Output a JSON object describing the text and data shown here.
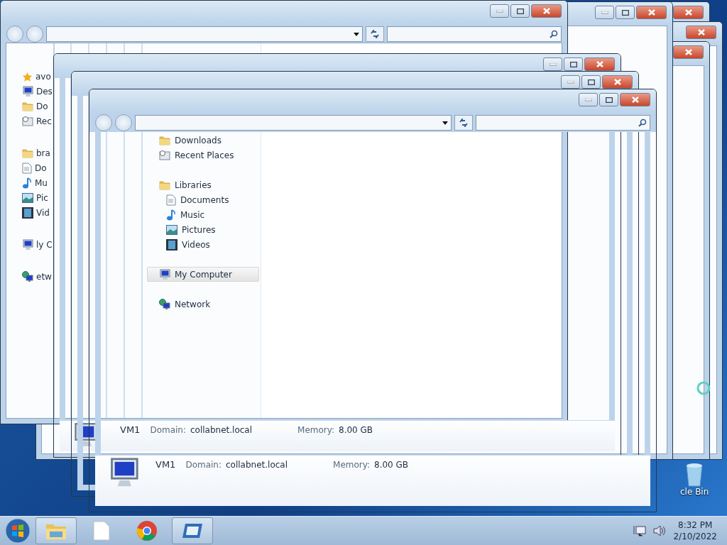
{
  "windows": [
    {
      "kind": "frame"
    },
    {
      "kind": "frame"
    },
    {
      "kind": "frame"
    },
    {
      "kind": "frame"
    },
    {
      "kind": "main",
      "nav_clipped": [
        {
          "label": "avo",
          "children": [
            {
              "label": "Des"
            },
            {
              "label": "Do"
            },
            {
              "label": "Rec"
            }
          ]
        },
        {
          "label": "bra",
          "children": [
            {
              "label": "Do"
            },
            {
              "label": "Mu"
            },
            {
              "label": "Pic"
            },
            {
              "label": "Vid"
            }
          ]
        },
        {
          "label": "ly C"
        },
        {
          "label": "etw"
        }
      ],
      "nav": [
        {
          "label": "Downloads",
          "selected": false
        },
        {
          "label": "Recent Places",
          "selected": false
        },
        {
          "label": "Libraries",
          "selected": false,
          "children": [
            {
              "label": "Documents",
              "selected": false
            },
            {
              "label": "Music",
              "selected": false
            },
            {
              "label": "Pictures",
              "selected": false
            },
            {
              "label": "Videos",
              "selected": false
            }
          ]
        },
        {
          "label": "My Computer",
          "selected": true
        },
        {
          "label": "Network",
          "selected": false
        }
      ]
    },
    {
      "kind": "ghost",
      "details": {
        "name": "VM1",
        "domain_label": "Domain:",
        "domain": "collabnet.local",
        "memory_label": "Memory:",
        "memory": "8.00 GB"
      }
    },
    {
      "kind": "ghost"
    },
    {
      "kind": "ghost",
      "details": {
        "name": "VM1",
        "domain_label": "Domain:",
        "domain": "collabnet.local",
        "memory_label": "Memory:",
        "memory": "8.00 GB"
      }
    }
  ],
  "desktop_icons": [
    {
      "label": "cle Bin"
    }
  ],
  "taskbar": {
    "buttons": [
      {
        "selected": true
      },
      {
        "selected": false
      },
      {
        "selected": false
      },
      {
        "selected": true
      }
    ],
    "clock": {
      "time": "8:32 PM",
      "date": "2/10/2022"
    }
  }
}
